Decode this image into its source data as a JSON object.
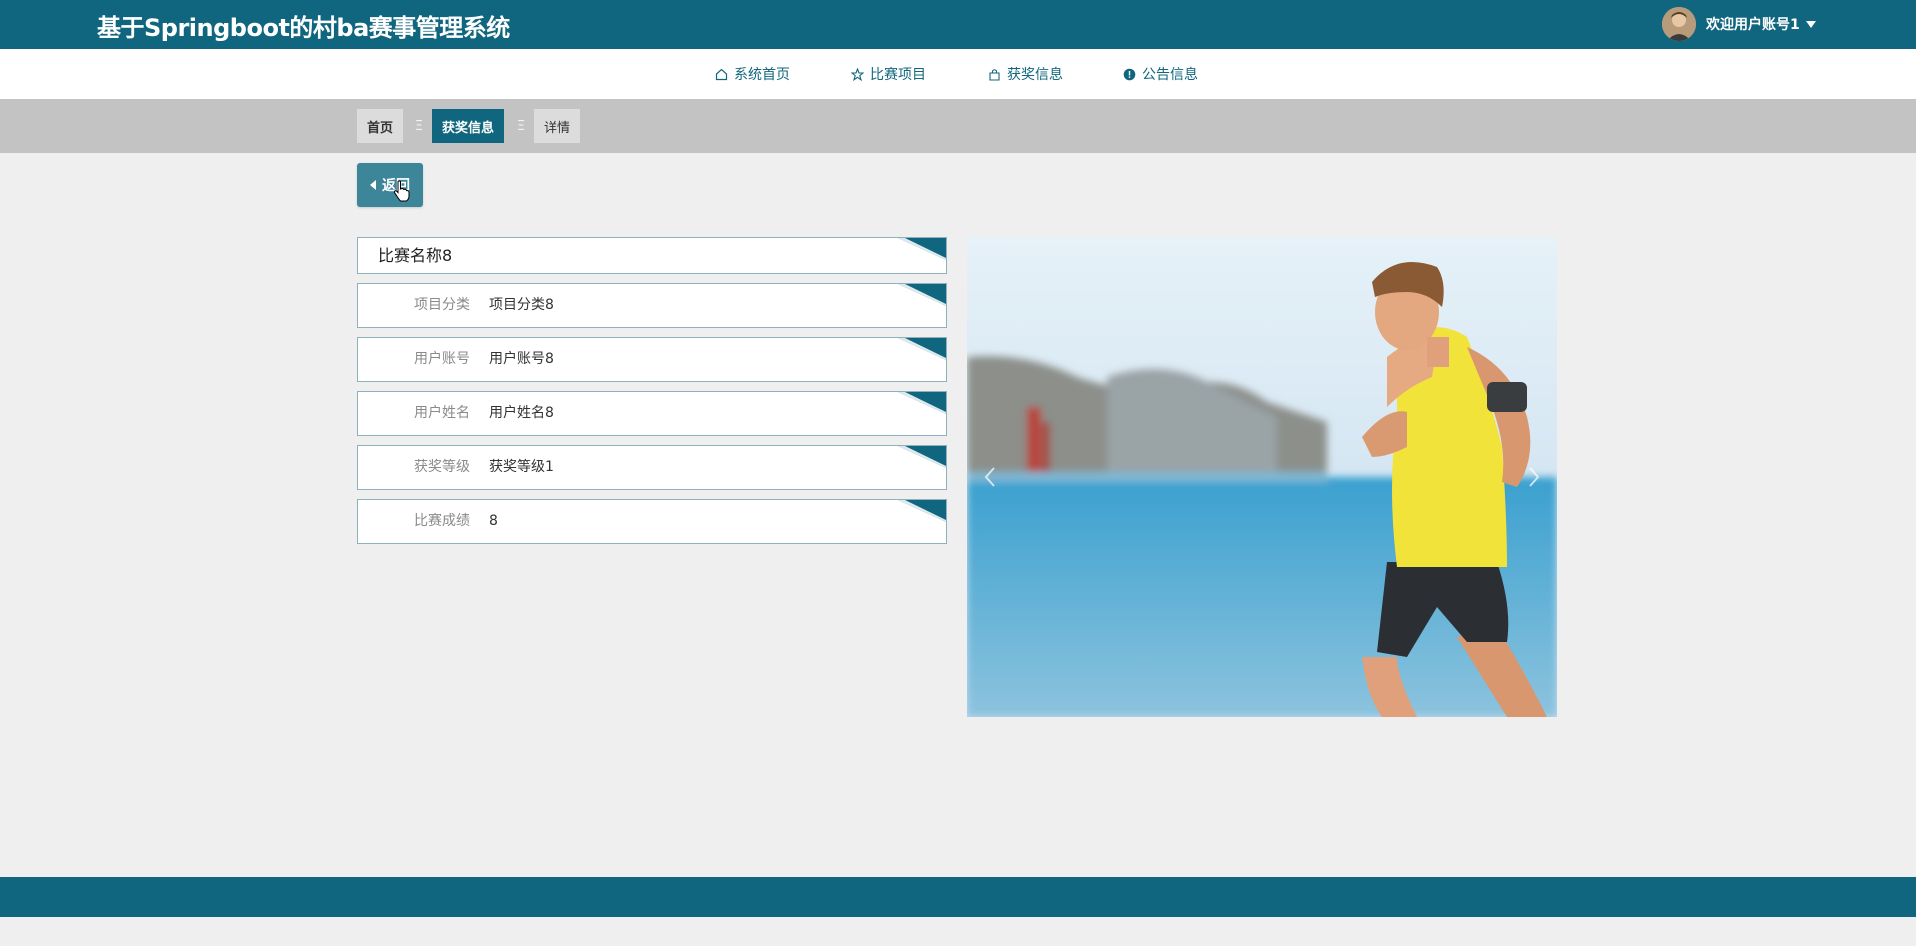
{
  "header": {
    "title": "基于Springboot的村ba赛事管理系统",
    "user_label": "欢迎用户账号1"
  },
  "nav": {
    "items": [
      {
        "label": "系统首页",
        "icon": "home-icon"
      },
      {
        "label": "比赛项目",
        "icon": "star-icon"
      },
      {
        "label": "获奖信息",
        "icon": "bag-icon"
      },
      {
        "label": "公告信息",
        "icon": "notice-icon"
      }
    ]
  },
  "breadcrumb": {
    "items": [
      "首页",
      "获奖信息",
      "详情"
    ],
    "separator": "Ξ"
  },
  "back_button": {
    "label": "返回",
    "icon": "caret-left-icon"
  },
  "detail": {
    "title": "比赛名称8",
    "fields": [
      {
        "label": "项目分类",
        "value": "项目分类8"
      },
      {
        "label": "用户账号",
        "value": "用户账号8"
      },
      {
        "label": "用户姓名",
        "value": "用户姓名8"
      },
      {
        "label": "获奖等级",
        "value": "获奖等级1"
      },
      {
        "label": "比赛成绩",
        "value": "8"
      }
    ]
  },
  "carousel": {
    "image": "runner-photo",
    "prev_icon": "chevron-left-icon",
    "next_icon": "chevron-right-icon"
  },
  "colors": {
    "primary": "#10667e",
    "button": "#3d8598",
    "breadcrumb_bg": "#c3c3c3",
    "page_bg": "#efefef"
  }
}
